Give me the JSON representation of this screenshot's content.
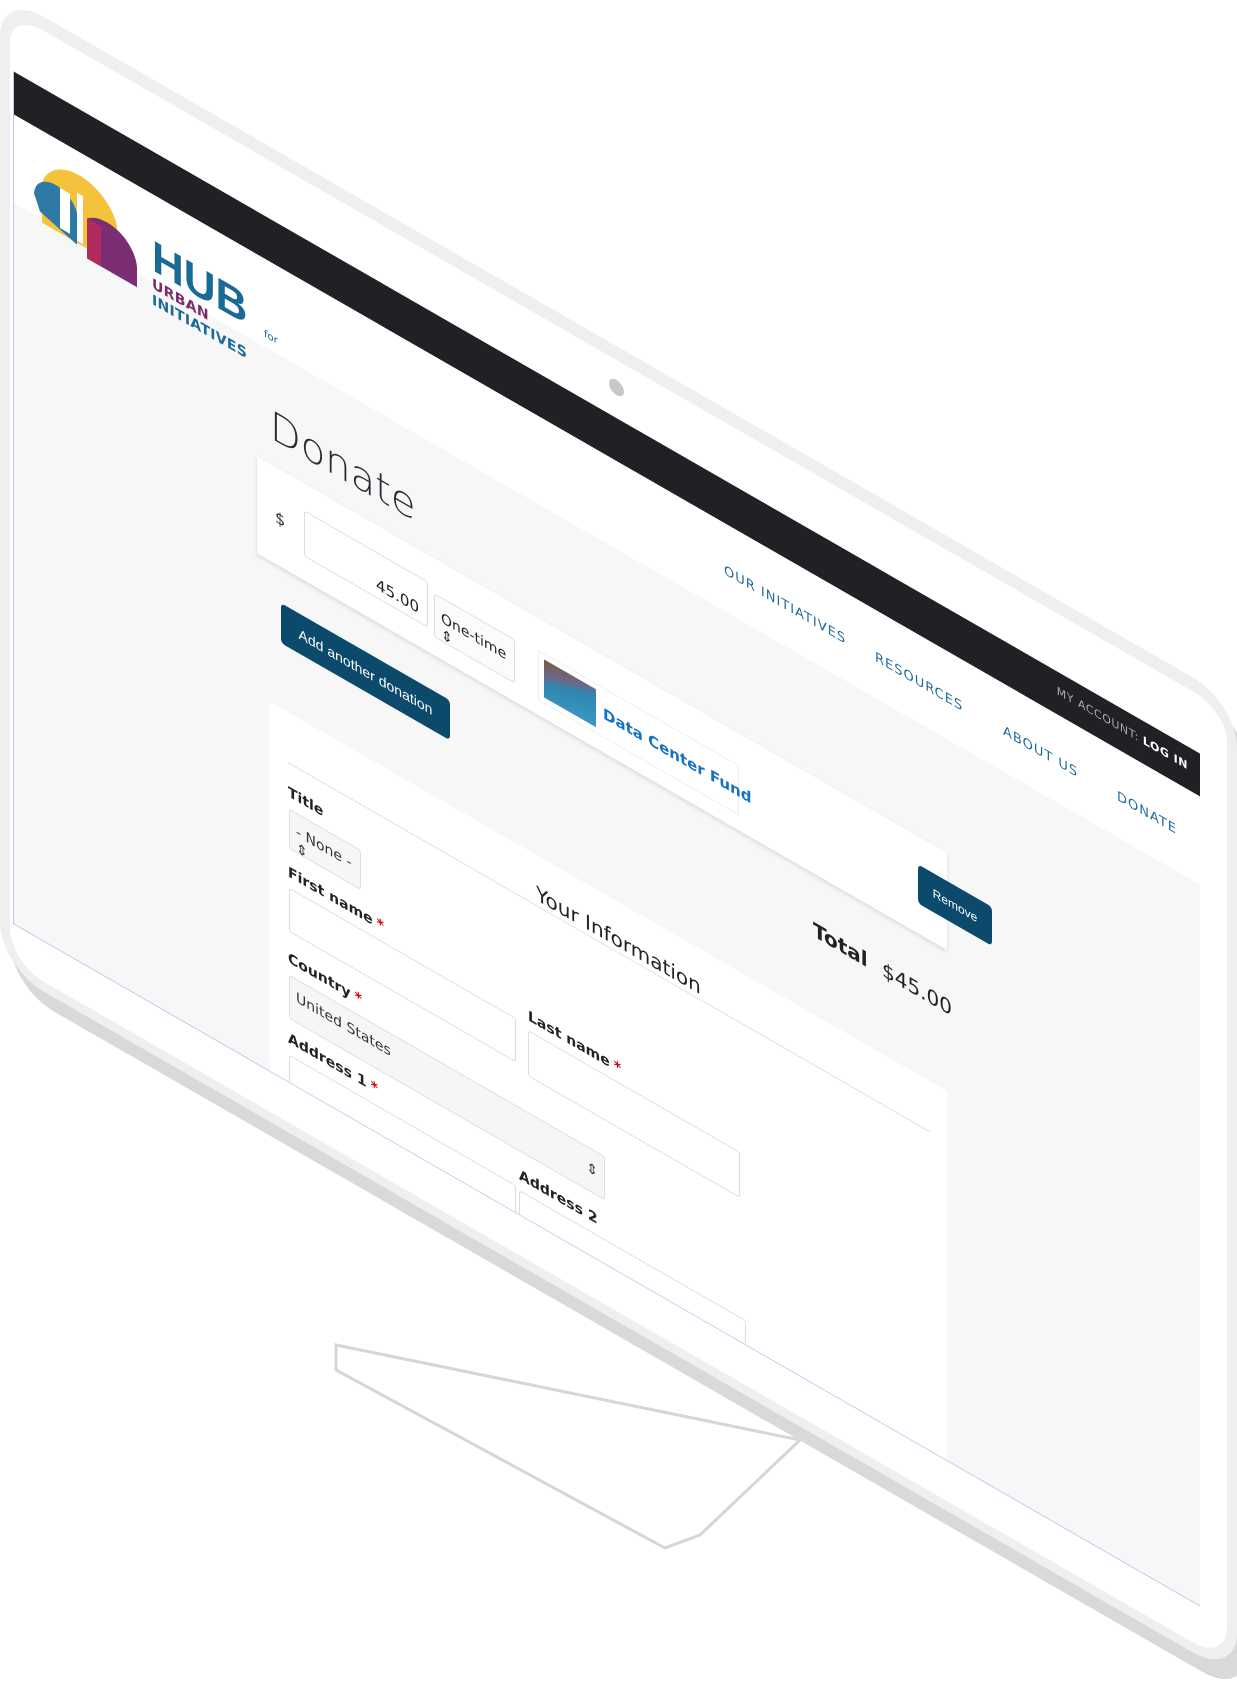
{
  "header": {
    "account_label": "MY ACCOUNT:",
    "login_label": "LOG IN",
    "logo": {
      "name": "HUB",
      "for": "for",
      "subtitle_a": "URBAN",
      "subtitle_b": "INITIATIVES"
    },
    "nav": [
      {
        "label": "OUR INITIATIVES"
      },
      {
        "label": "RESOURCES"
      },
      {
        "label": "ABOUT US"
      },
      {
        "label": "DONATE"
      }
    ]
  },
  "page": {
    "title": "Donate"
  },
  "donation": {
    "currency": "$",
    "amount": "45.00",
    "frequency": "One-time",
    "fund": "Data Center Fund",
    "remove_label": "Remove",
    "add_label": "Add another donation",
    "total_label": "Total",
    "total_value": "$45.00"
  },
  "info": {
    "legend": "Your Information",
    "required_mark": "*",
    "title_label": "Title",
    "title_value": "- None -",
    "first_name_label": "First name",
    "last_name_label": "Last name",
    "country_label": "Country",
    "country_value": "United States",
    "address1_label": "Address 1",
    "address2_label": "Address 2"
  },
  "colors": {
    "button": "#0b4a6b",
    "nav": "#1e6e98",
    "link": "#1572c0",
    "topbar": "#202124"
  }
}
